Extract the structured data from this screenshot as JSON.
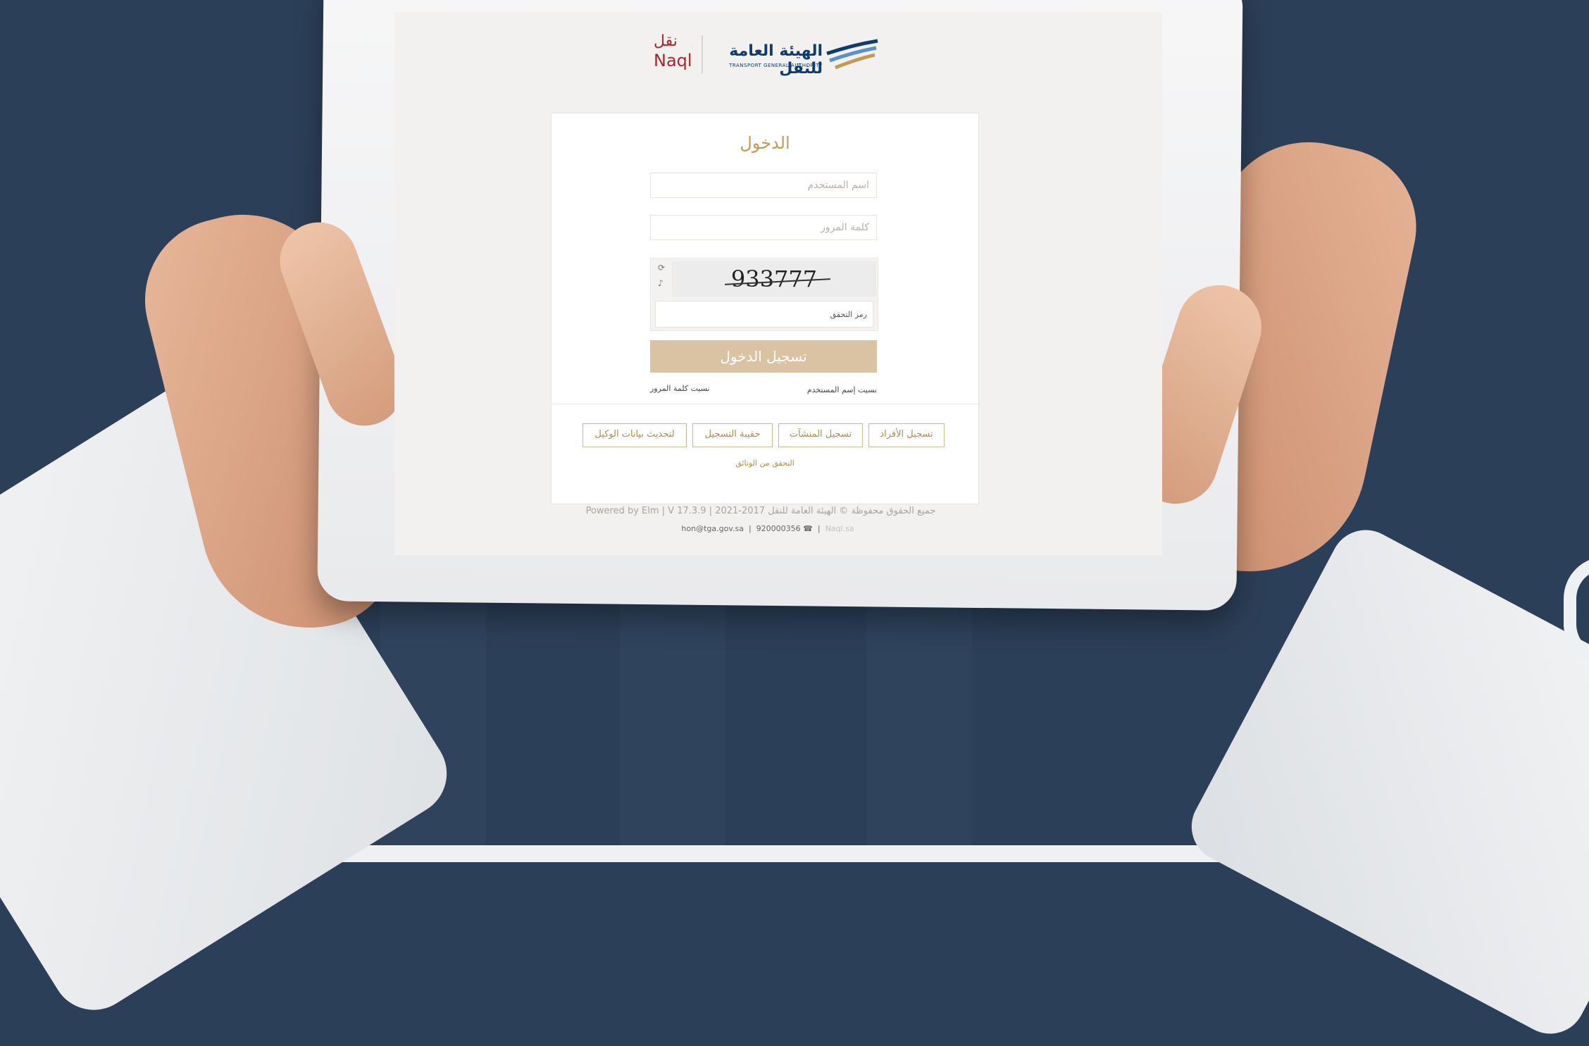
{
  "logo": {
    "naql_ar": "نقل",
    "naql_en": "Naql",
    "tga_ar": "الهيئة العامة للنقل",
    "tga_en": "TRANSPORT GENERAL AUTHORITY"
  },
  "login": {
    "title": "الدخول",
    "username_placeholder": "اسم المستخدم",
    "password_placeholder": "كلمة المرور",
    "captcha_code": "933777",
    "captcha_label": "رمز التحقق",
    "login_button": "تسجيل الدخول",
    "forgot_password": "نسيت كلمة المرور",
    "forgot_username": "نسيت إسم المستخدم"
  },
  "actions": {
    "register_individuals": "تسجيل الأفراد",
    "register_establishments": "تسجيل المنشآت",
    "register_guide": "حقيبة التسجيل",
    "update_agent_data": "لتحديث بيانات الوكيل",
    "verify_docs": "التحقق من الوثائق"
  },
  "footer": {
    "powered": "Powered by Elm | V 17.3.9 | 2021-2017 جميع الحقوق محفوظة © الهيئة العامة للنقل",
    "email": "hon@tga.gov.sa",
    "phone": "920000356",
    "extra": "Naql.sa"
  },
  "colors": {
    "background": "#2c3f58",
    "accent_gold": "#c49a52",
    "button_fill": "#d9c3a2",
    "brand_red": "#b0232a",
    "brand_blue": "#0d3c6e"
  }
}
